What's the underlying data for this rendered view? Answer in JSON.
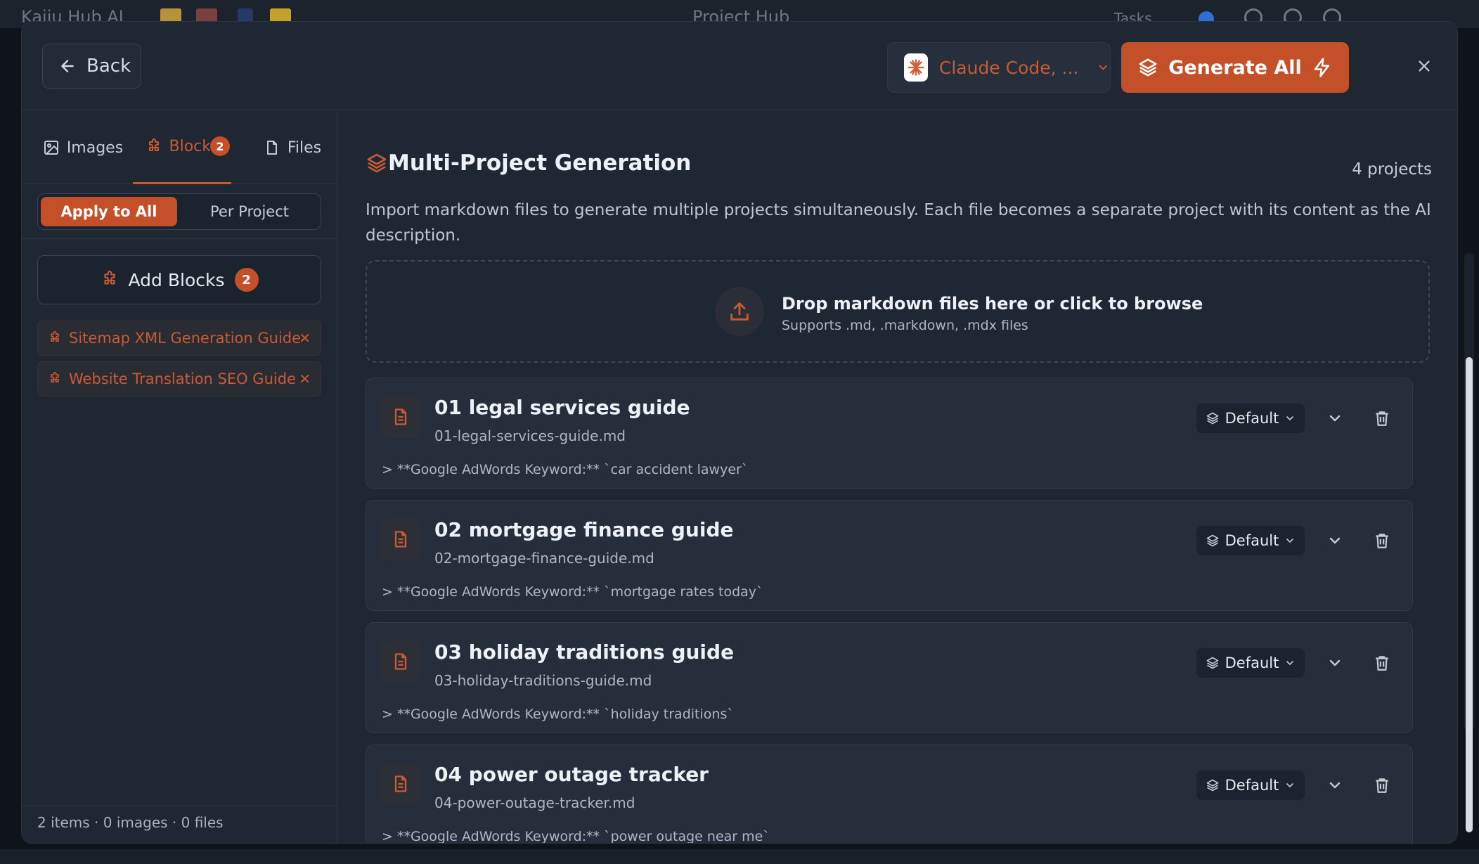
{
  "background_app": {
    "title": "Kaiju Hub AI",
    "window_title": "Project Hub",
    "tasks_label": "Tasks"
  },
  "header": {
    "back_label": "Back",
    "model_label": "Claude Code, ...",
    "generate_all_label": "Generate All"
  },
  "sidebar": {
    "tabs": [
      {
        "label": "Images",
        "icon": "image-icon"
      },
      {
        "label": "Blocks",
        "icon": "puzzle-icon",
        "badge": "2"
      },
      {
        "label": "Files",
        "icon": "file-icon"
      }
    ],
    "scope_toggle": {
      "apply_all": "Apply to All",
      "per_project": "Per Project"
    },
    "add_blocks_label": "Add Blocks",
    "add_blocks_count": "2",
    "blocks": [
      {
        "label": "Sitemap XML Generation Guide"
      },
      {
        "label": "Website Translation SEO Guide"
      }
    ],
    "footer": "2 items · 0 images · 0 files"
  },
  "main": {
    "title": "Multi-Project Generation",
    "project_count": "4 projects",
    "description": "Import markdown files to generate multiple projects simultaneously. Each file becomes a separate project with its content as the AI description.",
    "dropzone": {
      "title": "Drop markdown files here or click to browse",
      "subtitle": "Supports .md, .markdown, .mdx files"
    },
    "projects": [
      {
        "name": "01 legal services guide",
        "file": "01-legal-services-guide.md",
        "keyword": "> **Google AdWords Keyword:** `car accident lawyer`",
        "template": "Default"
      },
      {
        "name": "02 mortgage finance guide",
        "file": "02-mortgage-finance-guide.md",
        "keyword": "> **Google AdWords Keyword:** `mortgage rates today`",
        "template": "Default"
      },
      {
        "name": "03 holiday traditions guide",
        "file": "03-holiday-traditions-guide.md",
        "keyword": "> **Google AdWords Keyword:** `holiday traditions`",
        "template": "Default"
      },
      {
        "name": "04 power outage tracker",
        "file": "04-power-outage-tracker.md",
        "keyword": "> **Google AdWords Keyword:** `power outage near me`",
        "template": "Default"
      }
    ]
  },
  "colors": {
    "accent": "#c4502a",
    "accent_text": "#c85a35",
    "panel": "#1f2733",
    "card": "#252e3a"
  }
}
